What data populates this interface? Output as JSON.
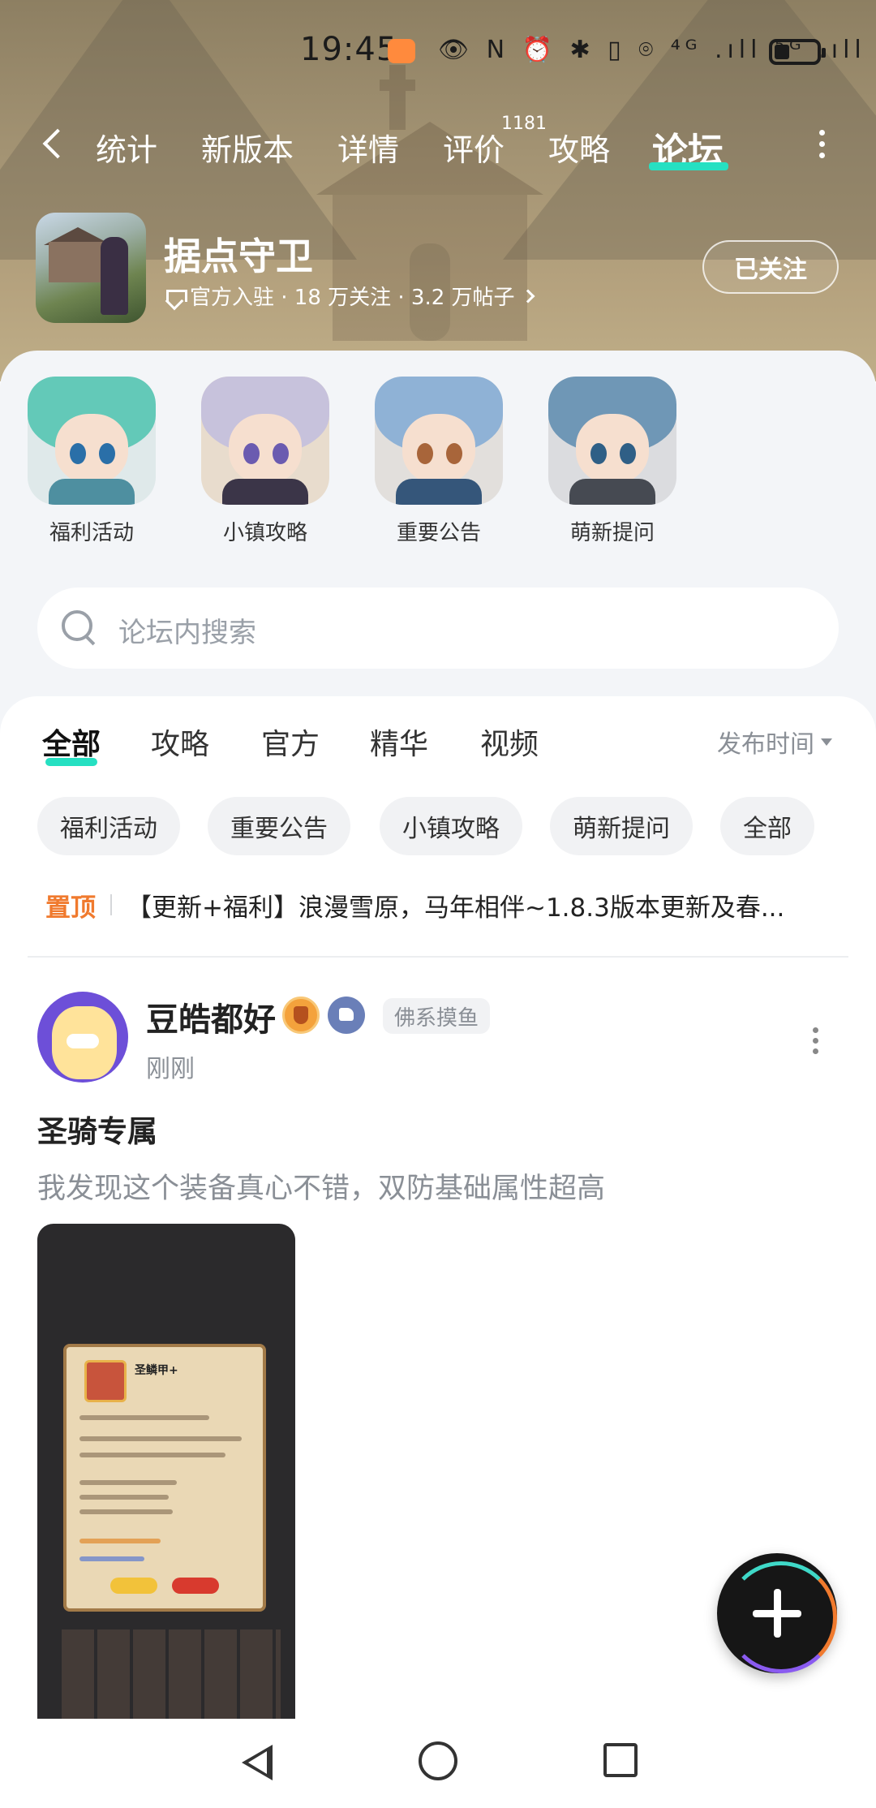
{
  "status_bar": {
    "time": "19:45",
    "icons_text": "👁 Ν ⏰ ✱ ▯ ⌾ ⁴ᴳ .ıll ⁵ᴳ .ıll"
  },
  "top_tabs": {
    "items": [
      "统计",
      "新版本",
      "详情",
      "评价",
      "攻略",
      "论坛"
    ],
    "active": "论坛",
    "review_count": "1181"
  },
  "game": {
    "title": "据点守卫",
    "meta": "官方入驻 · 18 万关注 · 3.2 万帖子",
    "follow_label": "已关注"
  },
  "quick_entries": [
    {
      "label": "福利活动",
      "icon": "anime-girl-teal-hair-avatar"
    },
    {
      "label": "小镇攻略",
      "icon": "anime-girl-silver-hair-avatar"
    },
    {
      "label": "重要公告",
      "icon": "anime-boy-catears-avatar"
    },
    {
      "label": "萌新提问",
      "icon": "anime-girl-headphones-avatar"
    }
  ],
  "search": {
    "placeholder": "论坛内搜索"
  },
  "feed_tabs": {
    "items": [
      "全部",
      "攻略",
      "官方",
      "精华",
      "视频"
    ],
    "active": "全部",
    "sort_label": "发布时间"
  },
  "chips": [
    "福利活动",
    "重要公告",
    "小镇攻略",
    "萌新提问",
    "全部"
  ],
  "pinned": {
    "tag": "置顶",
    "text": "【更新+福利】浪漫雪原，马年相伴~1.8.3版本更新及春..."
  },
  "post": {
    "author": "豆皓都好",
    "author_tag": "佛系摸鱼",
    "time": "刚刚",
    "title": "圣骑专属",
    "body": "我发现这个装备真心不错，双防基础属性超高",
    "image_item_name": "圣鳞甲+"
  },
  "colors": {
    "accent": "#26e0c2",
    "pin": "#f07a2e",
    "muted": "#8a8f96"
  }
}
